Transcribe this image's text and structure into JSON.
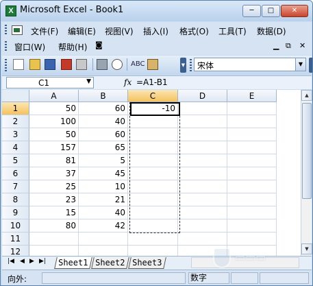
{
  "window": {
    "app_icon": "X",
    "title": "Microsoft Excel - Book1",
    "min": "─",
    "max": "□",
    "close": "✕"
  },
  "menubar": {
    "items": [
      "文件(F)",
      "编辑(E)",
      "视图(V)",
      "插入(I)",
      "格式(O)",
      "工具(T)",
      "数据(D)",
      "窗口(W)",
      "帮助(H)"
    ],
    "doc_min": "▁",
    "doc_restore": "⧉",
    "doc_close": "✕"
  },
  "toolbar": {
    "font_name": "宋体",
    "spell_label": "ABC"
  },
  "formulabar": {
    "name_box": "C1",
    "fx": "fx",
    "formula": "=A1-B1"
  },
  "grid": {
    "columns": [
      "A",
      "B",
      "C",
      "D",
      "E"
    ],
    "selected_column": "C",
    "rows": [
      {
        "row": "1",
        "a": "50",
        "b": "60",
        "c": "-10"
      },
      {
        "row": "2",
        "a": "100",
        "b": "40",
        "c": ""
      },
      {
        "row": "3",
        "a": "50",
        "b": "60",
        "c": ""
      },
      {
        "row": "4",
        "a": "157",
        "b": "65",
        "c": ""
      },
      {
        "row": "5",
        "a": "81",
        "b": "5",
        "c": ""
      },
      {
        "row": "6",
        "a": "37",
        "b": "45",
        "c": ""
      },
      {
        "row": "7",
        "a": "25",
        "b": "10",
        "c": ""
      },
      {
        "row": "8",
        "a": "23",
        "b": "21",
        "c": ""
      },
      {
        "row": "9",
        "a": "15",
        "b": "40",
        "c": ""
      },
      {
        "row": "10",
        "a": "80",
        "b": "42",
        "c": ""
      },
      {
        "row": "11",
        "a": "",
        "b": "",
        "c": ""
      },
      {
        "row": "12",
        "a": "",
        "b": "",
        "c": ""
      }
    ],
    "selected_row": "1"
  },
  "sheets": {
    "tabs": [
      "Sheet1",
      "Sheet2",
      "Sheet3"
    ],
    "active": "Sheet1"
  },
  "status": {
    "mode": "向外:",
    "indicator": "数字"
  },
  "colors": {
    "accent": "#f5c25e",
    "title_bg": "#c8dcf2"
  }
}
